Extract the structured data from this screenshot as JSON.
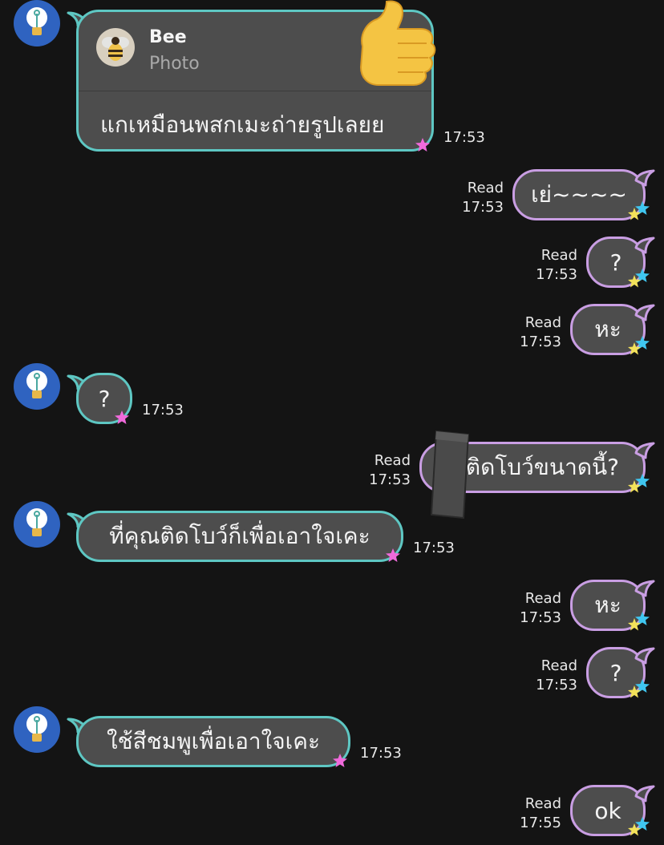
{
  "colors": {
    "background": "#141414",
    "bubble_fill": "#4d4d4d",
    "incoming_border": "#5ec7c3",
    "outgoing_border": "#c99ee3",
    "avatar_bg": "#2f63c0"
  },
  "quote": {
    "sender": "Bee",
    "type": "Photo",
    "message": "แกเหมือนพสกเมะถ่ายรูปเลยย",
    "time": "17:53"
  },
  "messages": [
    {
      "dir": "out",
      "text": "เย่~~~~",
      "read": "Read",
      "time": "17:53"
    },
    {
      "dir": "out",
      "text": "?",
      "read": "Read",
      "time": "17:53"
    },
    {
      "dir": "out",
      "text": "หะ",
      "read": "Read",
      "time": "17:53"
    },
    {
      "dir": "in",
      "text": "?",
      "time": "17:53"
    },
    {
      "dir": "out",
      "text": "ติดโบว์ขนาดนี้?",
      "read": "Read",
      "time": "17:53"
    },
    {
      "dir": "in",
      "text": "ที่คุณติดโบว์ก็เพื่อเอาใจเคะ",
      "time": "17:53"
    },
    {
      "dir": "out",
      "text": "หะ",
      "read": "Read",
      "time": "17:53"
    },
    {
      "dir": "out",
      "text": "?",
      "read": "Read",
      "time": "17:53"
    },
    {
      "dir": "in",
      "text": "ใช้สีชมพูเพื่อเอาใจเคะ",
      "time": "17:53"
    },
    {
      "dir": "out",
      "text": "ok",
      "read": "Read",
      "time": "17:55"
    }
  ],
  "stickers": [
    "thumbs-up",
    "tape-strip"
  ]
}
